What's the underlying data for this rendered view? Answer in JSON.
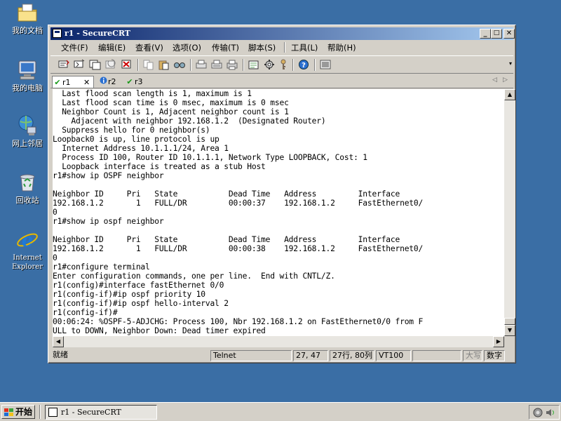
{
  "desktop": {
    "icons": [
      {
        "label": "我的文档",
        "icon": "folder-documents-icon"
      },
      {
        "label": "我的电脑",
        "icon": "my-computer-icon"
      },
      {
        "label": "网上邻居",
        "icon": "network-places-icon"
      },
      {
        "label": "回收站",
        "icon": "recycle-bin-icon"
      },
      {
        "label": "Internet Explorer",
        "icon": "internet-explorer-icon"
      }
    ]
  },
  "window": {
    "title": "r1 - SecureCRT",
    "controls": {
      "minimize": "_",
      "maximize": "□",
      "close": "✕"
    }
  },
  "menu": [
    "文件(F)",
    "编辑(E)",
    "查看(V)",
    "选项(O)",
    "传输(T)",
    "脚本(S)",
    "工具(L)",
    "帮助(H)"
  ],
  "tabs": [
    {
      "label": "r1",
      "status": "connected",
      "close": "✕"
    },
    {
      "label": "r2",
      "status": "info"
    },
    {
      "label": "r3",
      "status": "connected"
    }
  ],
  "terminal": {
    "lines": [
      "  Last flood scan length is 1, maximum is 1",
      "  Last flood scan time is 0 msec, maximum is 0 msec",
      "  Neighbor Count is 1, Adjacent neighbor count is 1",
      "    Adjacent with neighbor 192.168.1.2  (Designated Router)",
      "  Suppress hello for 0 neighbor(s)",
      "Loopback0 is up, line protocol is up",
      "  Internet Address 10.1.1.1/24, Area 1",
      "  Process ID 100, Router ID 10.1.1.1, Network Type LOOPBACK, Cost: 1",
      "  Loopback interface is treated as a stub Host",
      "r1#show ip OSPF neighbor",
      "",
      "Neighbor ID     Pri   State           Dead Time   Address         Interface",
      "192.168.1.2       1   FULL/DR         00:00:37    192.168.1.2     FastEthernet0/",
      "0",
      "r1#show ip ospf neighbor",
      "",
      "Neighbor ID     Pri   State           Dead Time   Address         Interface",
      "192.168.1.2       1   FULL/DR         00:00:38    192.168.1.2     FastEthernet0/",
      "0",
      "r1#configure terminal",
      "Enter configuration commands, one per line.  End with CNTL/Z.",
      "r1(config)#interface fastEthernet 0/0",
      "r1(config-if)#ip ospf priority 10",
      "r1(config-if)#ip ospf hello-interval 2",
      "r1(config-if)#",
      "00:06:24: %OSPF-5-ADJCHG: Process 100, Nbr 192.168.1.2 on FastEthernet0/0 from F",
      "ULL to DOWN, Neighbor Down: Dead timer expired"
    ]
  },
  "status_bar": {
    "ready": "就绪",
    "protocol": "Telnet",
    "cursor": "27, 47",
    "size": "27行, 80列",
    "emulation": "VT100",
    "blank": "",
    "caps": "大写",
    "num": "数字"
  },
  "taskbar": {
    "start_label": "开始",
    "task_label": "r1 - SecureCRT"
  }
}
